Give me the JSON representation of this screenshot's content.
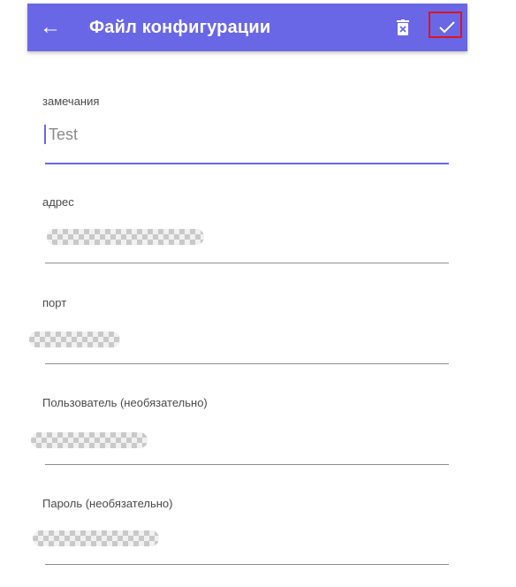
{
  "appbar": {
    "title": "Файл конфигурации",
    "back_icon": "arrow-left-icon",
    "delete_icon": "trash-icon",
    "confirm_icon": "check-icon",
    "background_color": "#6a67e6",
    "highlight_color": "#e0141c"
  },
  "form": {
    "fields": [
      {
        "label": "замечания",
        "value": "Test",
        "focused": true
      },
      {
        "label": "адрес",
        "value": "",
        "obscured": true
      },
      {
        "label": "порт",
        "value": "",
        "obscured": true
      },
      {
        "label": "Пользователь (необязательно)",
        "value": "",
        "obscured": true
      },
      {
        "label": "Пароль (необязательно)",
        "value": "",
        "obscured": true
      }
    ]
  }
}
